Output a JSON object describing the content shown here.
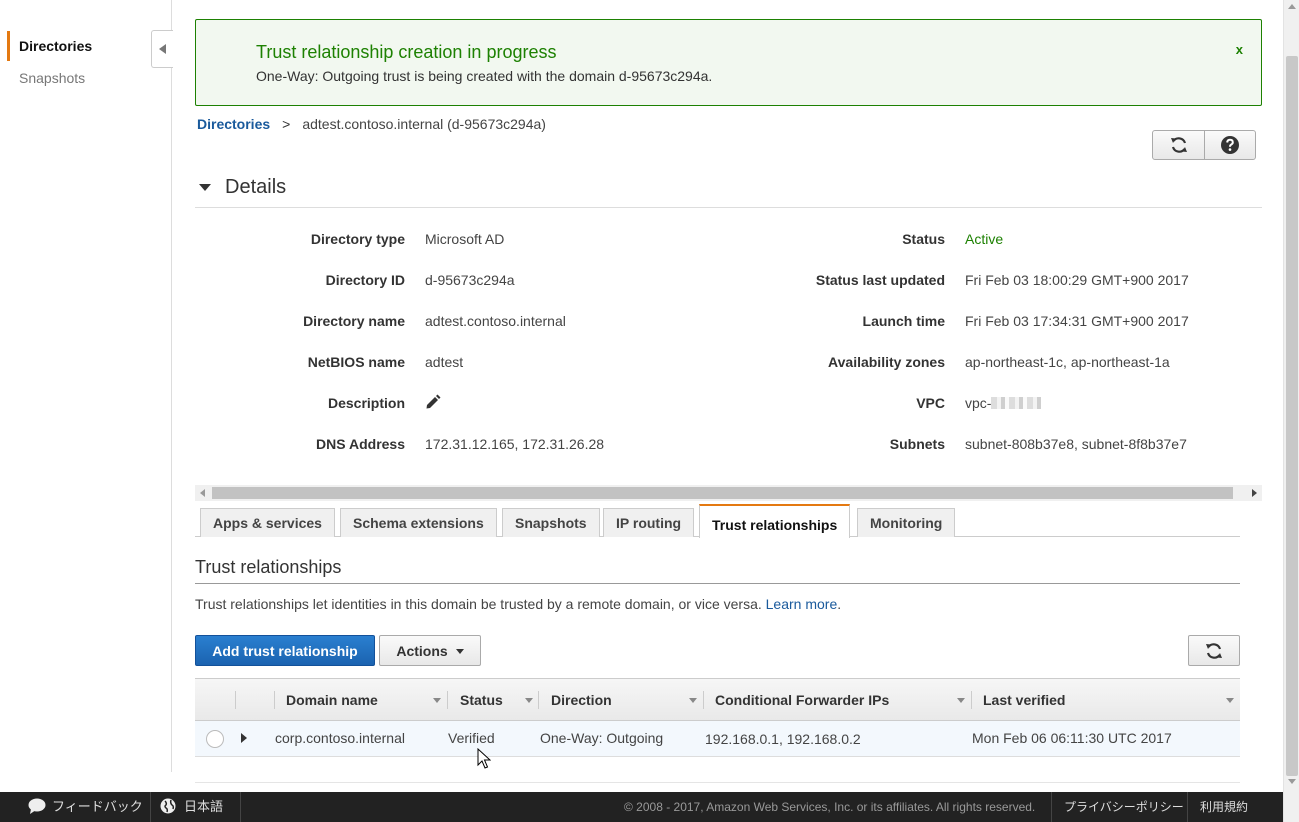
{
  "sidebar": {
    "items": [
      {
        "label": "Directories"
      },
      {
        "label": "Snapshots"
      }
    ]
  },
  "flash": {
    "title": "Trust relationship creation in progress",
    "message": "One-Way: Outgoing trust is being created with the domain d-95673c294a.",
    "close_label": "x"
  },
  "breadcrumb": {
    "root": "Directories",
    "separator": ">",
    "current": "adtest.contoso.internal (d-95673c294a)"
  },
  "details": {
    "title": "Details",
    "left": [
      {
        "label": "Directory type",
        "value": "Microsoft AD"
      },
      {
        "label": "Directory ID",
        "value": "d-95673c294a"
      },
      {
        "label": "Directory name",
        "value": "adtest.contoso.internal"
      },
      {
        "label": "NetBIOS name",
        "value": "adtest"
      },
      {
        "label": "Description",
        "value": ""
      },
      {
        "label": "DNS Address",
        "value": "172.31.12.165, 172.31.26.28"
      }
    ],
    "right": [
      {
        "label": "Status",
        "value": "Active"
      },
      {
        "label": "Status last updated",
        "value": "Fri Feb 03 18:00:29 GMT+900 2017"
      },
      {
        "label": "Launch time",
        "value": "Fri Feb 03 17:34:31 GMT+900 2017"
      },
      {
        "label": "Availability zones",
        "value": "ap-northeast-1c, ap-northeast-1a"
      },
      {
        "label": "VPC",
        "value": "vpc-"
      },
      {
        "label": "Subnets",
        "value": "subnet-808b37e8, subnet-8f8b37e7"
      }
    ]
  },
  "tabs": [
    {
      "label": "Apps & services"
    },
    {
      "label": "Schema extensions"
    },
    {
      "label": "Snapshots"
    },
    {
      "label": "IP routing"
    },
    {
      "label": "Trust relationships"
    },
    {
      "label": "Monitoring"
    }
  ],
  "trust": {
    "title": "Trust relationships",
    "description": "Trust relationships let identities in this domain be trusted by a remote domain, or vice versa.",
    "learn_more": "Learn more",
    "period": ".",
    "add_button": "Add trust relationship",
    "actions_button": "Actions",
    "columns": [
      "Domain name",
      "Status",
      "Direction",
      "Conditional Forwarder IPs",
      "Last verified"
    ],
    "rows": [
      {
        "domain": "corp.contoso.internal",
        "status": "Verified",
        "direction": "One-Way: Outgoing",
        "forwarders": "192.168.0.1, 192.168.0.2",
        "last_verified": "Mon Feb 06 06:11:30 UTC 2017"
      }
    ]
  },
  "footer": {
    "feedback": "フィードバック",
    "language": "日本語",
    "copyright": "© 2008 - 2017, Amazon Web Services, Inc. or its affiliates. All rights reserved.",
    "privacy": "プライバシーポリシー",
    "terms": "利用規約"
  },
  "colors": {
    "accent": "#e47911",
    "success": "#1d8102",
    "link": "#1a5a9c",
    "primary_button": "#1b63b0"
  },
  "icons": [
    "chevron-left-icon",
    "refresh-icon",
    "help-icon",
    "pencil-icon",
    "caret-down-icon",
    "expand-icon",
    "speech-bubble-icon",
    "globe-icon"
  ]
}
